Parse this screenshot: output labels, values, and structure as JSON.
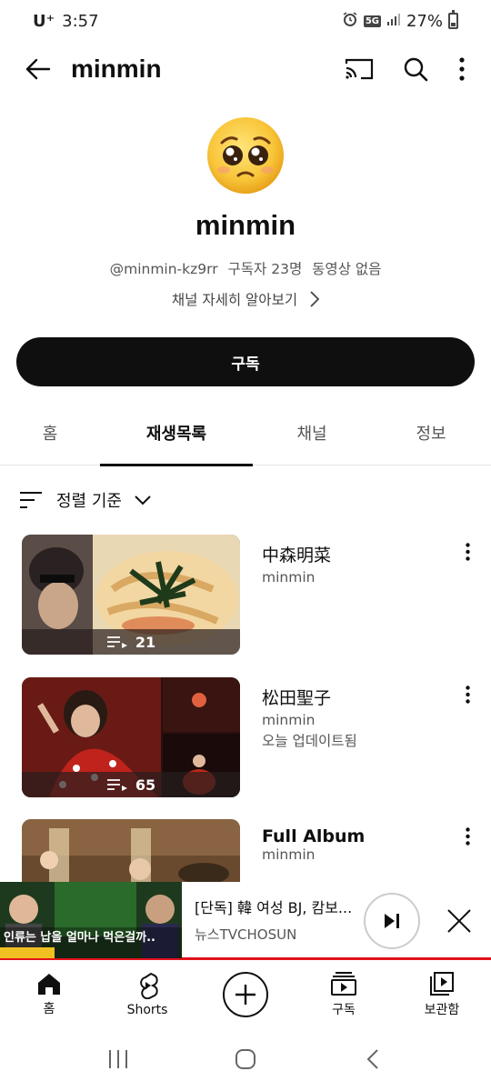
{
  "status_bar": {
    "carrier": "U⁺",
    "time": "3:57",
    "network": "5G",
    "battery": "27%"
  },
  "app_bar": {
    "title": "minmin"
  },
  "channel": {
    "name": "minmin",
    "handle": "@minmin-kz9rr",
    "subscribers": "구독자 23명",
    "videos": "동영상 없음",
    "more_label": "채널 자세히 알아보기",
    "subscribe_label": "구독"
  },
  "tabs": [
    {
      "label": "홈"
    },
    {
      "label": "재생목록",
      "active": true
    },
    {
      "label": "채널"
    },
    {
      "label": "정보"
    }
  ],
  "sort_label": "정렬 기준",
  "playlists": [
    {
      "title": "中森明菜",
      "channel": "minmin",
      "updated": "",
      "count": "21"
    },
    {
      "title": "松田聖子",
      "channel": "minmin",
      "updated": "오늘 업데이트됨",
      "count": "65"
    },
    {
      "title": "Full Album",
      "channel": "minmin",
      "updated": "",
      "count": ""
    }
  ],
  "mini_player": {
    "title": "[단독] 韓 여성 BJ, 캄보...",
    "channel": "뉴스TVCHOSUN",
    "thumb_caption": "인류는 납을 얼마나 먹은걸까.."
  },
  "bottom_nav": [
    {
      "label": "홈",
      "icon": "home-icon"
    },
    {
      "label": "Shorts",
      "icon": "shorts-icon"
    },
    {
      "label": "",
      "icon": "create-icon"
    },
    {
      "label": "구독",
      "icon": "subscriptions-icon"
    },
    {
      "label": "보관함",
      "icon": "library-icon"
    }
  ],
  "colors": {
    "accent": "#0f0f0f",
    "mini_player_bar": "#e2131b"
  }
}
